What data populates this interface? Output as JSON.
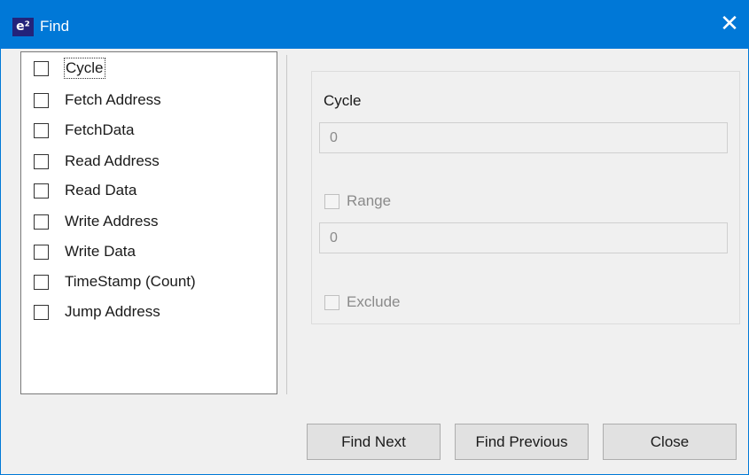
{
  "window": {
    "title": "Find",
    "app_icon_text": "e²",
    "close_glyph": "✕",
    "accent_color": "#0078d7"
  },
  "fields_list": {
    "items": [
      {
        "label": "Cycle",
        "checked": false,
        "focused": true
      },
      {
        "label": "Fetch Address",
        "checked": false
      },
      {
        "label": "FetchData",
        "checked": false
      },
      {
        "label": "Read Address",
        "checked": false
      },
      {
        "label": "Read Data",
        "checked": false
      },
      {
        "label": "Write Address",
        "checked": false
      },
      {
        "label": "Write Data",
        "checked": false
      },
      {
        "label": "TimeStamp (Count)",
        "checked": false
      },
      {
        "label": "Jump Address",
        "checked": false
      }
    ]
  },
  "detail": {
    "field_label": "Cycle",
    "value": "0",
    "range_label": "Range",
    "range_checked": false,
    "range_value": "0",
    "exclude_label": "Exclude",
    "exclude_checked": false
  },
  "buttons": {
    "find_next": "Find Next",
    "find_previous": "Find Previous",
    "close": "Close"
  }
}
